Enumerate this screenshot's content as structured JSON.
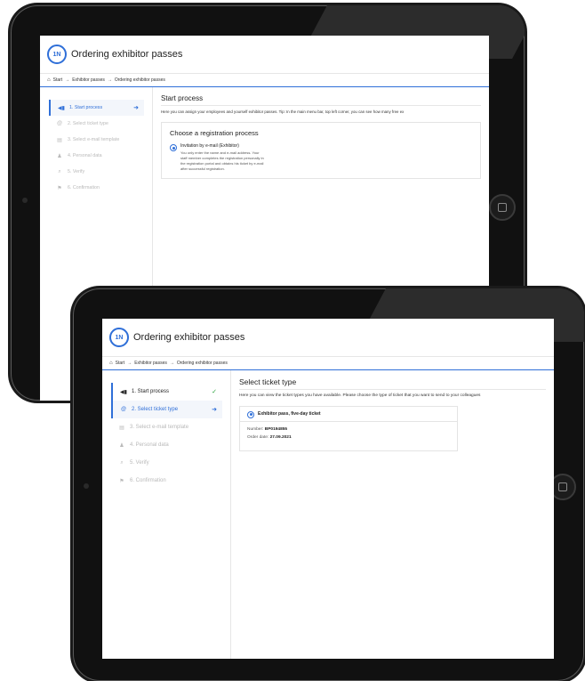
{
  "colors": {
    "accent": "#2f6fd8",
    "done": "#2aa33c",
    "frame": "#111111"
  },
  "back_screen": {
    "app_title": "Ordering exhibitor passes",
    "logo_text": "1N",
    "breadcrumb": [
      "Start",
      "Exhibitor passes",
      "Ordering exhibitor passes"
    ],
    "steps": [
      {
        "label": "1. Start process",
        "icon": "megaphone-icon",
        "glyph": "◀▮"
      },
      {
        "label": "2. Select ticket type",
        "icon": "at-icon",
        "glyph": "@"
      },
      {
        "label": "3. Select e-mail template",
        "icon": "email-template-icon",
        "glyph": "▤"
      },
      {
        "label": "4. Personal data",
        "icon": "person-icon",
        "glyph": "♟"
      },
      {
        "label": "5. Verify",
        "icon": "search-icon",
        "glyph": "⌕"
      },
      {
        "label": "6. Confirmation",
        "icon": "flag-icon",
        "glyph": "⚑"
      }
    ],
    "heading": "Start process",
    "intro": "Here you can assign your employees and yourself exhibitor passes. Tip: In the main menu bar, top left corner, you can see how many free ex",
    "card_title": "Choose a registration process",
    "option_title": "Invitation by e-mail (Exhibitor)",
    "option_desc": "You only enter the name and e-mail address. Your staff member completes the registration personally in the registration portal and obtains his ticket by e-mail after successful registration."
  },
  "front_screen": {
    "app_title": "Ordering exhibitor passes",
    "logo_text": "1N",
    "breadcrumb": [
      "Start",
      "Exhibitor passes",
      "Ordering exhibitor passes"
    ],
    "steps": [
      {
        "label": "1. Start process",
        "icon": "megaphone-icon",
        "glyph": "◀▮"
      },
      {
        "label": "2. Select ticket type",
        "icon": "at-icon",
        "glyph": "@"
      },
      {
        "label": "3. Select e-mail template",
        "icon": "email-template-icon",
        "glyph": "▤"
      },
      {
        "label": "4. Personal data",
        "icon": "person-icon",
        "glyph": "♟"
      },
      {
        "label": "5. Verify",
        "icon": "search-icon",
        "glyph": "⌕"
      },
      {
        "label": "6. Confirmation",
        "icon": "flag-icon",
        "glyph": "⚑"
      }
    ],
    "heading": "Select ticket type",
    "intro": "Here you can view the ticket types you have available. Please choose the type of ticket that you want to send to your colleagues",
    "ticket_name": "Exhibitor pass, five-day ticket",
    "number_label": "Number:",
    "number_value": "BP0194855",
    "date_label": "Order date:",
    "date_value": "27.09.2021"
  },
  "icons": {
    "arrow": "→",
    "check": "✓",
    "current_arrow": "➜",
    "home": "⌂"
  }
}
